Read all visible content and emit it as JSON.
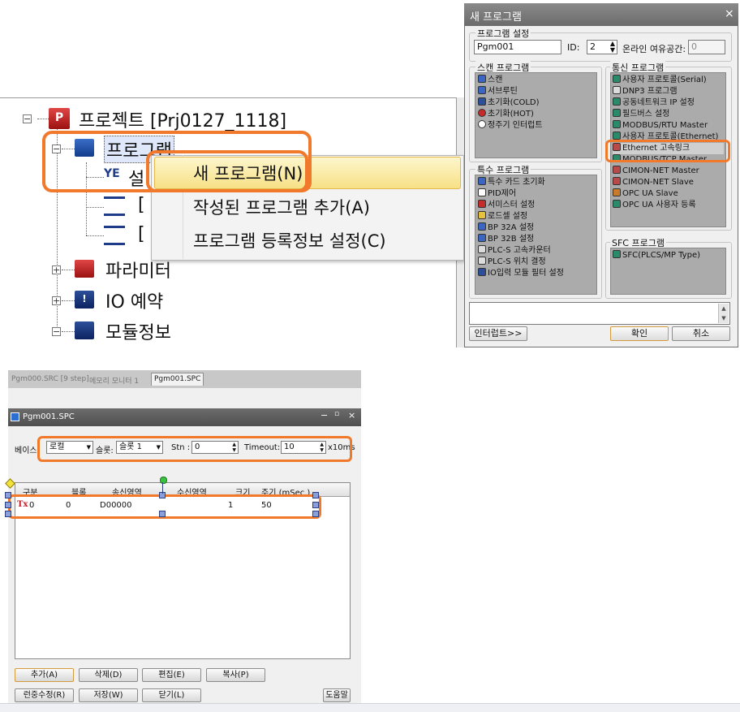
{
  "tree": {
    "project": "프로젝트 [Prj0127_1118]",
    "program": "프로그램",
    "parameter": "파라미터",
    "io": "IO 예약",
    "module": "모듈정보",
    "child_frag": "[",
    "child_frag2": "[",
    "child_frag_s": "설"
  },
  "context_menu": {
    "items": [
      "새 프로그램(N)",
      "작성된 프로그램 추가(A)",
      "프로그램 등록정보 설정(C)"
    ]
  },
  "dialog": {
    "title": "새 프로그램",
    "close": "×",
    "settings_label": "프로그램 설정",
    "program_name": "Pgm001",
    "id_label": "ID:",
    "id_value": "2",
    "online_label": "온라인 여유공간:",
    "online_value": "0",
    "scan": {
      "label": "스캔 프로그램",
      "items": [
        "스캔",
        "서브루틴",
        "초기화(COLD)",
        "초기화(HOT)",
        "정주기 인터럽트"
      ]
    },
    "comm": {
      "label": "통신 프로그램",
      "items": [
        "사용자 프로토콜(Serial)",
        "DNP3 프로그램",
        "공동네트워크 IP 설정",
        "필드버스 설정",
        "MODBUS/RTU Master",
        "사용자 프로토콜(Ethernet)",
        "Ethernet 고속링크",
        "MODBUS/TCP Master",
        "CIMON-NET Master",
        "CIMON-NET Slave",
        "OPC UA Slave",
        "OPC UA 사용자 등록"
      ]
    },
    "special": {
      "label": "특수 프로그램",
      "items": [
        "특수 카드 초기화",
        "PID제어",
        "서미스터 설정",
        "로드셀 설정",
        "BP 32A 설정",
        "BP 32B 설정",
        "PLC-S 고속카운터",
        "PLC-S 위치 결정",
        "IO입력 모듈 필터 설정"
      ]
    },
    "sfc": {
      "label": "SFC 프로그램",
      "items": [
        "SFC(PLCS/MP Type)"
      ]
    },
    "interrupt_btn": "인터럽트>>",
    "ok_btn": "확인",
    "cancel_btn": "취소"
  },
  "editor": {
    "tabs": [
      "Pgm000.SRC [9 step]",
      "메모리 모니터 1",
      "Pgm001.SPC"
    ],
    "window_title": "Pgm001.SPC",
    "base_label": "베이스:",
    "base_value": "로컬",
    "slot_label": "슬롯:",
    "slot_value": "슬롯 1",
    "stn_label": "Stn :",
    "stn_value": "0",
    "timeout_label": "Timeout:",
    "timeout_value": "10",
    "timeout_unit": "x10ms",
    "columns": [
      "구분",
      "블록",
      "송신영역",
      "수신영역",
      "크기",
      "주기 (mSec )"
    ],
    "rows": [
      {
        "type": "Tx",
        "num": "0",
        "block": "0",
        "send": "D00000",
        "recv": "",
        "size": "1",
        "period": "50"
      }
    ],
    "buttons_row1": [
      "추가(A)",
      "삭제(D)",
      "편집(E)",
      "복사(P)"
    ],
    "buttons_row2": [
      "런중수정(R)",
      "저장(W)",
      "닫기(L)"
    ],
    "help": "도움말"
  },
  "colors": {
    "callout": "#f0792b",
    "menu_highlight": "#f7e186",
    "listbox": "#ababab"
  }
}
